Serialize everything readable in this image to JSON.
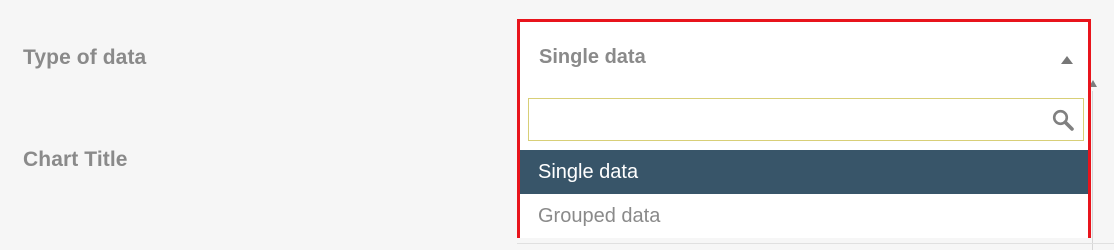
{
  "form": {
    "type_label": "Type of data",
    "chart_title_label": "Chart Title"
  },
  "dropdown": {
    "selected_value": "Single data",
    "search": {
      "value": "",
      "placeholder": ""
    },
    "options": [
      {
        "label": "Single data",
        "selected": true
      },
      {
        "label": "Grouped data",
        "selected": false
      }
    ]
  },
  "colors": {
    "highlight_border": "#e8141c",
    "selected_option_bg": "#385569",
    "search_border": "#d8cf77",
    "label_text": "#8a8a8a"
  },
  "icons": {
    "search": "search-icon",
    "caret": "caret-up-icon"
  }
}
